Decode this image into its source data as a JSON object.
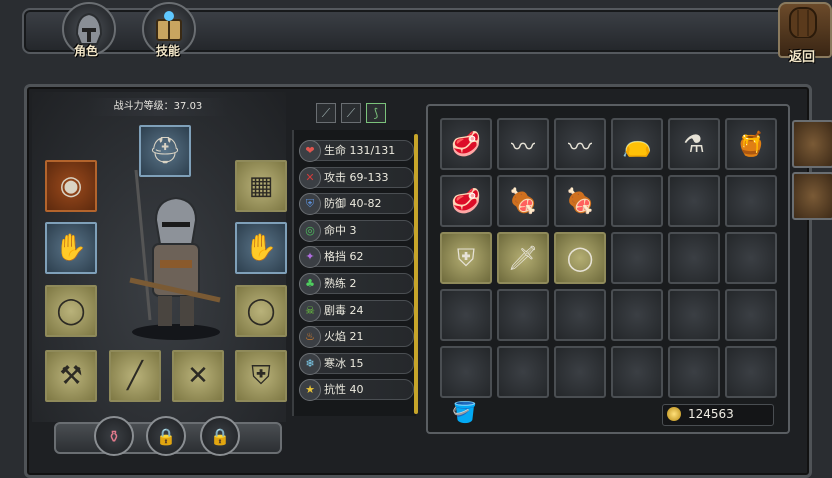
{
  "top_nav": {
    "character_label": "角色",
    "skills_label": "技能",
    "back_label": "返回"
  },
  "character_panel": {
    "power_label": "战斗力等级：37.03"
  },
  "filters": [
    {
      "icon": "sword-filter-icon"
    },
    {
      "icon": "spear-filter-icon"
    },
    {
      "icon": "bow-filter-icon"
    }
  ],
  "stats": [
    {
      "icon": "heart-icon",
      "glyph": "❤",
      "color": "#e0564f",
      "text": "生命 131/131"
    },
    {
      "icon": "attack-icon",
      "glyph": "✕",
      "color": "#d23b3b",
      "text": "攻击 69-133"
    },
    {
      "icon": "shield-icon",
      "glyph": "⛨",
      "color": "#5c8fd6",
      "text": "防御 40-82"
    },
    {
      "icon": "target-icon",
      "glyph": "◎",
      "color": "#4fbf5f",
      "text": "命中 3"
    },
    {
      "icon": "block-icon",
      "glyph": "✦",
      "color": "#b06de0",
      "text": "格挡 62"
    },
    {
      "icon": "clover-icon",
      "glyph": "♣",
      "color": "#4fcf5f",
      "text": "熟练 2"
    },
    {
      "icon": "poison-icon",
      "glyph": "☠",
      "color": "#6fcf3f",
      "text": "剧毒 24"
    },
    {
      "icon": "fire-icon",
      "glyph": "♨",
      "color": "#f08a2a",
      "text": "火焰 21"
    },
    {
      "icon": "ice-icon",
      "glyph": "❄",
      "color": "#7fd0f0",
      "text": "寒冰 15"
    },
    {
      "icon": "resist-icon",
      "glyph": "★",
      "color": "#e8c43a",
      "text": "抗性 40"
    }
  ],
  "inventory": {
    "gold_amount": "124563"
  }
}
